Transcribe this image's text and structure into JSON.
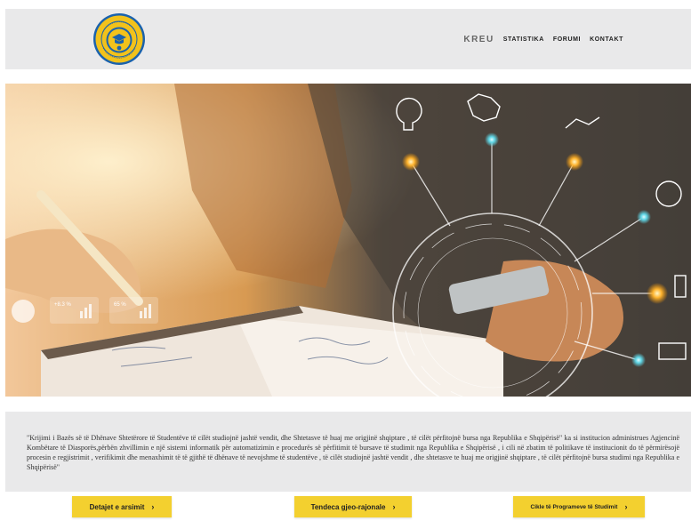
{
  "header": {
    "logo_icon": "university-seal-icon",
    "nav": [
      {
        "label": "KREU",
        "active": true
      },
      {
        "label": "STATISTIKA",
        "active": false
      },
      {
        "label": "FORUMI",
        "active": false
      },
      {
        "label": "KONTAKT",
        "active": false
      }
    ]
  },
  "hero": {
    "image": "person-writing-with-tech-network-icons",
    "overlay_stats": [
      "+8.3 %",
      "65 %"
    ]
  },
  "info": {
    "text": "\"Krijimi i Bazës së të Dhënave Shtetërore të Studentëve të cilët studiojnë jashtë vendit, dhe Shtetasve të huaj me origjinë shqiptare , të cilët përfitojnë bursa nga Republika e Shqipërisë\" ka si institucion administrues Agjencinë Kombëtare të Diasporës,përbën zhvillimin e një sistemi informatik për automatizimin e procedurës së përfitimit të bursave të studimit nga Republika e Shqipërisë , i cili në zbatim të politikave të institucionit do të përmirësojë procesin e regjistrimit , verifikimit dhe menaxhimit të të gjithë të dhënave të nevojshme të studentëve , të cilët studiojnë jashtë vendit , dhe shtetasve te huaj me origjinë shqiptare , të cilët përfitojnë bursa studimi nga Republika e Shqipërisë\""
  },
  "buttons": {
    "details": "Detajet e arsimit",
    "regional": "Tendeca gjeo-rajonale",
    "cycles": "Cikle të Programeve të Studimit",
    "chevron": "›"
  },
  "colors": {
    "accent_yellow": "#f3d02f",
    "header_bg": "#e9e9ea",
    "logo_blue": "#1a62ad",
    "logo_gold": "#f2c21b"
  }
}
